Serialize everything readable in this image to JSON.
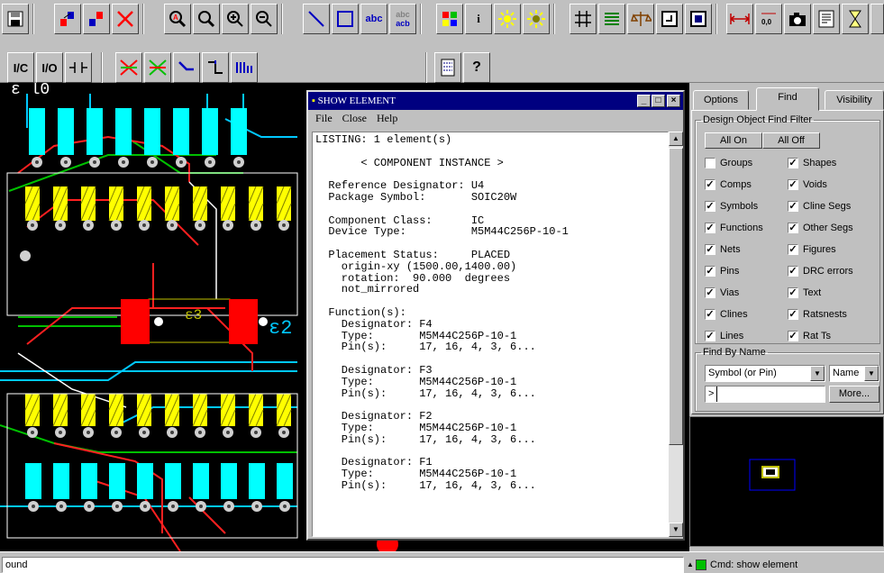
{
  "toolbar_row1": {
    "abc_label": "abc",
    "abc_acb_top": "abc",
    "abc_acb_bottom": "acb",
    "info_glyph": "i"
  },
  "toolbar_row2": {
    "ic_label": "I/C",
    "io_label": "I/O",
    "help_glyph": "?"
  },
  "show_element": {
    "title": "SHOW ELEMENT",
    "menu": [
      "File",
      "Close",
      "Help"
    ],
    "listing": "LISTING: 1 element(s)\n\n       < COMPONENT INSTANCE >\n\n  Reference Designator: U4\n  Package Symbol:       SOIC20W\n\n  Component Class:      IC\n  Device Type:          M5M44C256P-10-1\n\n  Placement Status:     PLACED\n    origin-xy (1500.00,1400.00)\n    rotation:  90.000  degrees\n    not_mirrored\n\n  Function(s):\n    Designator: F4\n    Type:       M5M44C256P-10-1\n    Pin(s):     17, 16, 4, 3, 6...\n\n    Designator: F3\n    Type:       M5M44C256P-10-1\n    Pin(s):     17, 16, 4, 3, 6...\n\n    Designator: F2\n    Type:       M5M44C256P-10-1\n    Pin(s):     17, 16, 4, 3, 6...\n\n    Designator: F1\n    Type:       M5M44C256P-10-1\n    Pin(s):     17, 16, 4, 3, 6..."
  },
  "panel": {
    "tabs": [
      "Options",
      "Find",
      "Visibility"
    ],
    "find_filter_title": "Design Object Find Filter",
    "all_on": "All On",
    "all_off": "All Off",
    "filters": [
      {
        "label": "Groups",
        "checked": false
      },
      {
        "label": "Shapes",
        "checked": true
      },
      {
        "label": "Comps",
        "checked": true
      },
      {
        "label": "Voids",
        "checked": true
      },
      {
        "label": "Symbols",
        "checked": true
      },
      {
        "label": "Cline Segs",
        "checked": true
      },
      {
        "label": "Functions",
        "checked": true
      },
      {
        "label": "Other Segs",
        "checked": true
      },
      {
        "label": "Nets",
        "checked": true
      },
      {
        "label": "Figures",
        "checked": true
      },
      {
        "label": "Pins",
        "checked": true
      },
      {
        "label": "DRC errors",
        "checked": true
      },
      {
        "label": "Vias",
        "checked": true
      },
      {
        "label": "Text",
        "checked": true
      },
      {
        "label": "Clines",
        "checked": true
      },
      {
        "label": "Ratsnests",
        "checked": true
      },
      {
        "label": "Lines",
        "checked": true
      },
      {
        "label": "Rat Ts",
        "checked": true
      }
    ],
    "find_by_name_title": "Find By Name",
    "find_type": "Symbol (or Pin)",
    "find_mode": "Name",
    "find_prefix": ">",
    "find_value": "",
    "more_button": "More..."
  },
  "canvas_labels": {
    "refdes_top": "ε l0",
    "refdes_mid": "ε3",
    "refdes_right": "ε2"
  },
  "status": {
    "message": "ound",
    "cmd_label": "Cmd:",
    "cmd_value": "show element"
  },
  "colors": {
    "pad_cyan": "#00ffff",
    "pad_yellow": "#ffff00",
    "trace_green": "#00c000",
    "trace_red": "#ff2020",
    "trace_cyan": "#00c8ff",
    "title_bar": "#000080"
  }
}
